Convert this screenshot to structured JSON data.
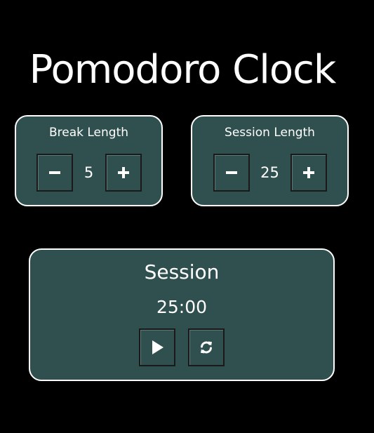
{
  "app": {
    "title": "Pomodoro Clock"
  },
  "break": {
    "label": "Break Length",
    "value": "5",
    "decrement_icon": "minus-icon",
    "increment_icon": "plus-icon"
  },
  "session": {
    "label": "Session Length",
    "value": "25",
    "decrement_icon": "minus-icon",
    "increment_icon": "plus-icon"
  },
  "timer": {
    "label": "Session",
    "time_left": "25:00",
    "start_stop_icon": "play-icon",
    "reset_icon": "refresh-icon"
  },
  "colors": {
    "background": "#000000",
    "panel": "#2f504f",
    "border": "#ffffff",
    "text": "#ffffff"
  }
}
